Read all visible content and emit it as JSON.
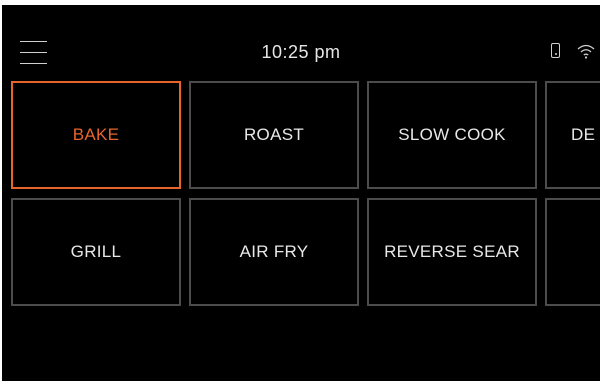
{
  "status_bar": {
    "menu_icon": "hamburger-menu-icon",
    "time": "10:25 pm",
    "phone_icon": "phone-icon",
    "wifi_icon": "wifi-icon"
  },
  "modes": [
    {
      "label": "BAKE",
      "selected": true
    },
    {
      "label": "ROAST",
      "selected": false
    },
    {
      "label": "SLOW COOK",
      "selected": false
    },
    {
      "label": "DE",
      "selected": false
    },
    {
      "label": "GRILL",
      "selected": false
    },
    {
      "label": "AIR FRY",
      "selected": false
    },
    {
      "label": "REVERSE SEAR",
      "selected": false
    },
    {
      "label": "",
      "selected": false
    }
  ],
  "colors": {
    "background": "#000000",
    "accent": "#e8642c",
    "tile_border": "#4c4c4c",
    "text": "#e8e8e8"
  }
}
